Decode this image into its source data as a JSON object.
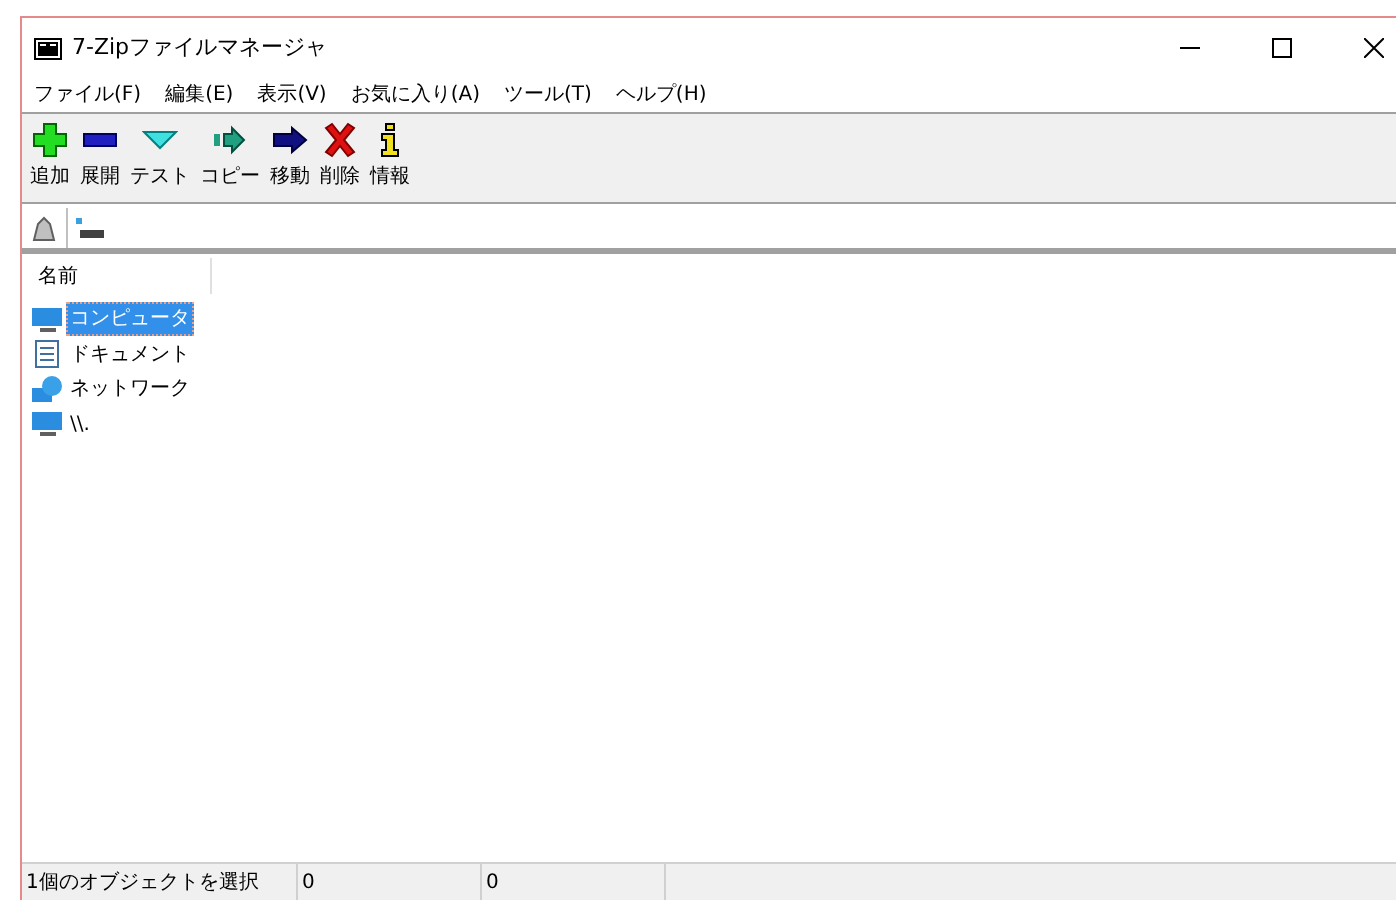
{
  "window": {
    "title": "7-Zipファイルマネージャ"
  },
  "menu": [
    "ファイル(F)",
    "編集(E)",
    "表示(V)",
    "お気に入り(A)",
    "ツール(T)",
    "ヘルプ(H)"
  ],
  "toolbar": [
    {
      "kind": "add",
      "label": "追加"
    },
    {
      "kind": "extract",
      "label": "展開"
    },
    {
      "kind": "test",
      "label": "テスト"
    },
    {
      "kind": "copy",
      "label": "コピー"
    },
    {
      "kind": "move",
      "label": "移動"
    },
    {
      "kind": "delete",
      "label": "削除"
    },
    {
      "kind": "info",
      "label": "情報"
    }
  ],
  "list": {
    "columns": [
      "名前"
    ],
    "items": [
      {
        "kind": "computer",
        "name": "コンピュータ",
        "selected": true
      },
      {
        "kind": "document",
        "name": "ドキュメント",
        "selected": false
      },
      {
        "kind": "network",
        "name": "ネットワーク",
        "selected": false
      },
      {
        "kind": "computer",
        "name": "\\\\.",
        "selected": false
      }
    ]
  },
  "status_bar": [
    "1個のオブジェクトを選択",
    "0",
    "0"
  ]
}
